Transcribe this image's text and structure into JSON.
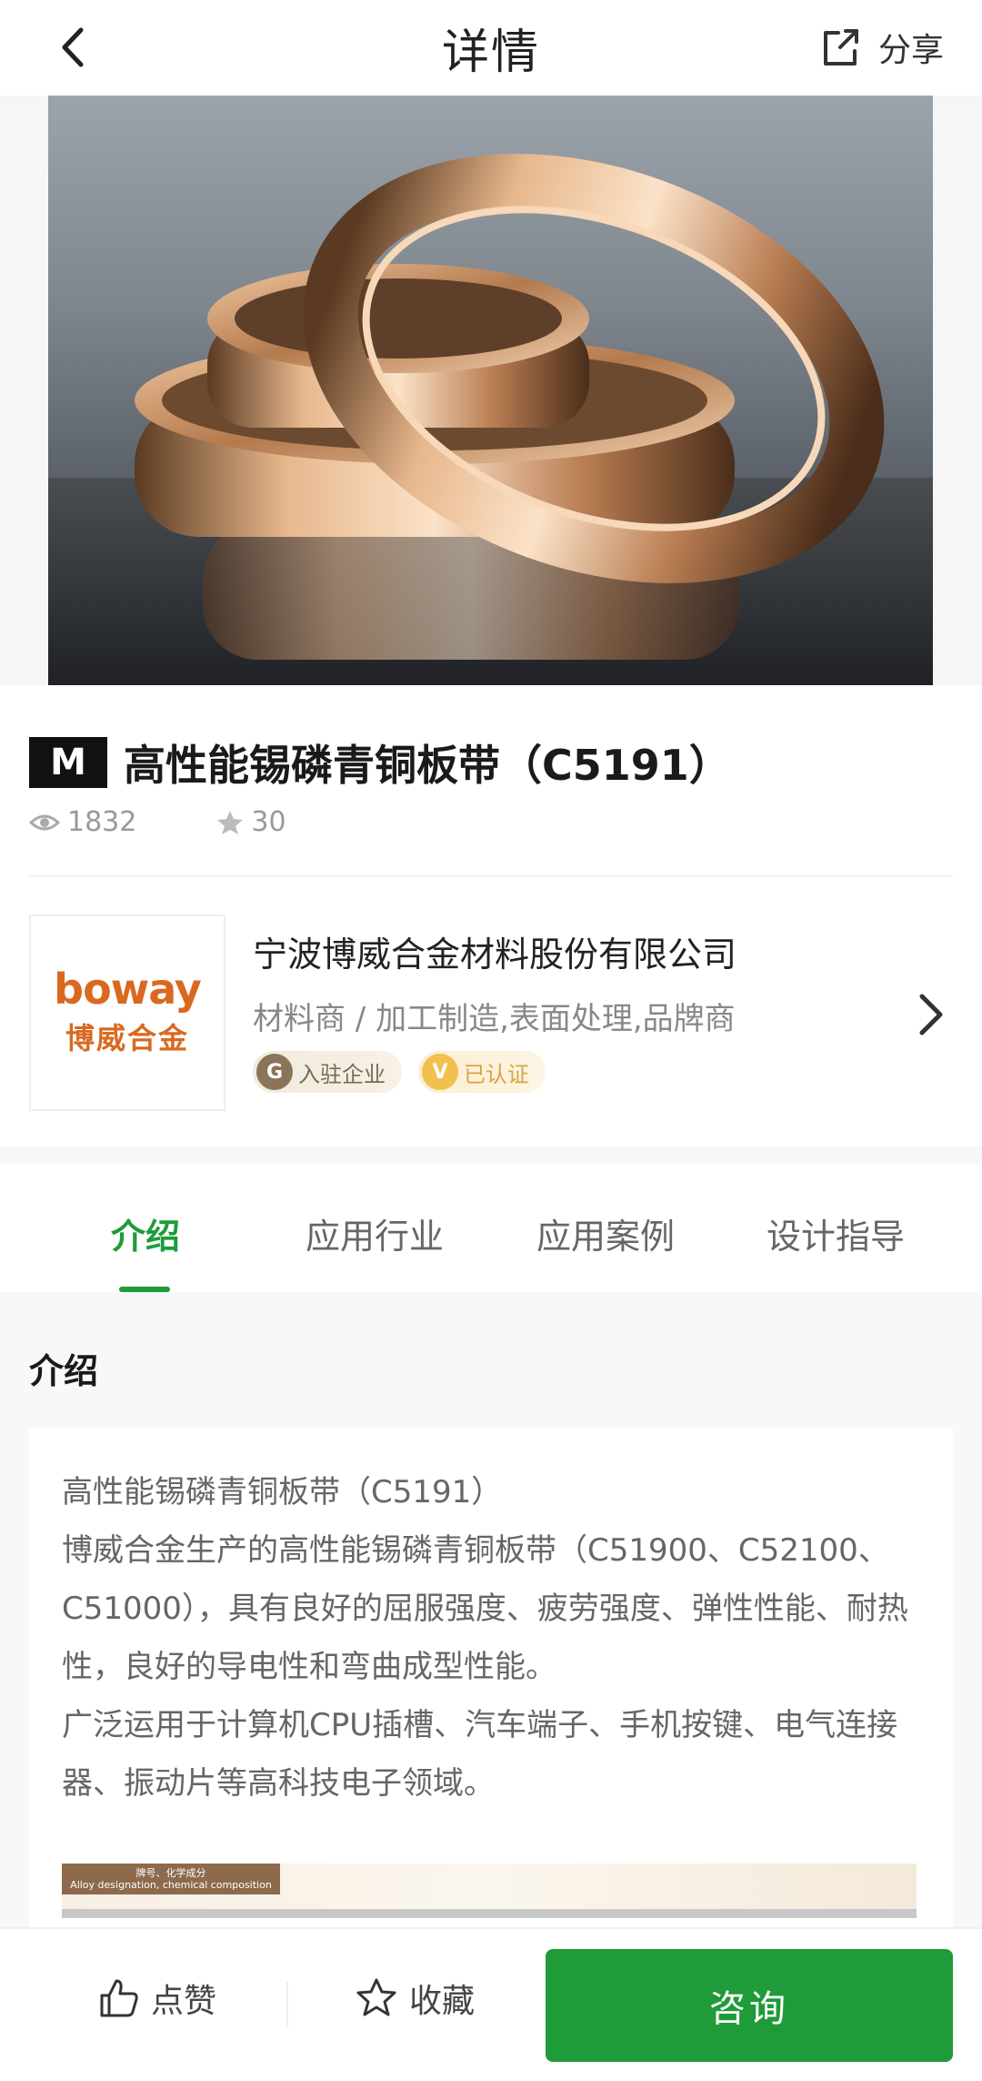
{
  "header": {
    "title": "详情",
    "share_label": "分享"
  },
  "product": {
    "badge": "M",
    "title": "高性能锡磷青铜板带（C5191）",
    "views": "1832",
    "favorites": "30"
  },
  "company": {
    "logo_en": "boway",
    "logo_cn": "博威合金",
    "name": "宁波博威合金材料股份有限公司",
    "tags": "材料商 / 加工制造,表面处理,品牌商",
    "badge_entered": "入驻企业",
    "badge_verified": "已认证"
  },
  "tabs": [
    {
      "label": "介绍",
      "active": true
    },
    {
      "label": "应用行业",
      "active": false
    },
    {
      "label": "应用案例",
      "active": false
    },
    {
      "label": "设计指导",
      "active": false
    }
  ],
  "intro": {
    "heading": "介绍",
    "line1": "高性能锡磷青铜板带（C5191）",
    "line2": "博威合金生产的高性能锡磷青铜板带（C51900、C52100、C51000），具有良好的屈服强度、疲劳强度、弹性性能、耐热性，良好的导电性和弯曲成型性能。",
    "line3": "广泛运用于计算机CPU插槽、汽车端子、手机按键、电气连接器、振动片等高科技电子领域。",
    "table_head_cn": "牌号、化学成分",
    "table_head_en": "Alloy designation, chemical composition"
  },
  "bottom": {
    "like_label": "点赞",
    "collect_label": "收藏",
    "consult_label": "咨询"
  },
  "colors": {
    "accent": "#1f9b3a",
    "logo": "#d9691f"
  }
}
